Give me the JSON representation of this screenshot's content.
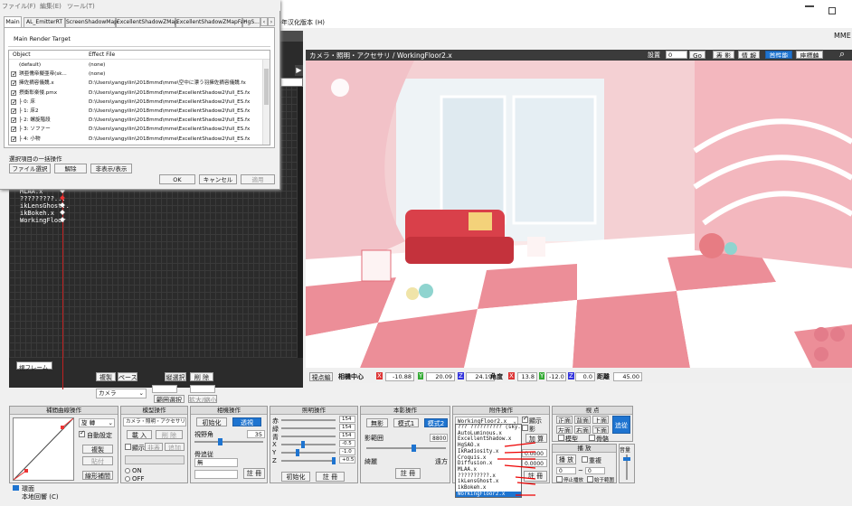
{
  "mmd": {
    "menu": [
      "ファイル(F)",
      "編集(E)",
      "ツール(T)"
    ],
    "title_fragment": "帰年汉化版本 (H)",
    "mme_label": "MME",
    "viewport_title": "カメラ・照明・アクセサリ / WorkingFloor2.x",
    "view_controls": {
      "display": "設置",
      "frame_value": "0",
      "go": "Go",
      "buttons": [
        "表 影",
        "情 報",
        "首性能",
        "座標軸"
      ]
    },
    "local_label": "LOCAL",
    "frame_tab": "視フレーム",
    "timeline_rows": [
      "MLAA.x",
      "?????????...",
      "ikLensGhost..",
      "ikBokeh.x",
      "WorkingFloor"
    ],
    "timeline_bottom": {
      "copy": "複製",
      "paste": "ペースト",
      "delete": "削 除",
      "range": "範囲選択",
      "vert_sel": "縦選択",
      "camera_select": "カメラ",
      "expand": "拡大/縮小"
    },
    "status": {
      "label": "視点編",
      "center": "相機中心",
      "x": "-10.88",
      "y": "20.09",
      "z": "24.19",
      "angle_label": "角度",
      "ax": "13.8",
      "ay": "-12.0",
      "az": "0.0",
      "dist_label": "距離",
      "dist": "45.00"
    },
    "panels": {
      "interp": {
        "title": "補間曲線操作",
        "select": "旋 轉",
        "auto": "自動設定",
        "copy": "複製",
        "paste": "貼付",
        "linear": "線形補間"
      },
      "model": {
        "title": "模型操作",
        "select": "カメラ・照明・アクセサリ",
        "register": "載 入",
        "delete": "削 除",
        "display": "顯示",
        "hide": "非表",
        "add": "追加",
        "on": "ON",
        "off": "OFF"
      },
      "camera": {
        "title": "相機操作",
        "init": "初始化",
        "perspective": "透視",
        "view_angle": "視野角",
        "angle_value": "35",
        "follow": "骨追従",
        "follow_select": "無",
        "register": "註 冊"
      },
      "lighting": {
        "title": "照明操作",
        "r_label": "赤",
        "g_label": "緑",
        "b_label": "青",
        "r": "154",
        "g": "154",
        "b": "154",
        "x": "-0.5",
        "y": "-1.0",
        "z": "+0.5",
        "init": "初始化",
        "register": "註 冊"
      },
      "shadow": {
        "title": "本影操作",
        "none": "無影",
        "mode1": "模式1",
        "mode2": "模式2",
        "range_label": "影範囲",
        "range": "8800",
        "near": "綺麗",
        "far": "遠方",
        "register": "註 冊"
      },
      "accessory": {
        "title": "附件操作",
        "selected": "WorkingFloor2.x",
        "show": "顯示",
        "shadow": "影",
        "add": "加 算",
        "value1": "0.0000",
        "value2": "0.0000",
        "register": "註 冊"
      },
      "view": {
        "title": "視 点",
        "front": "正面",
        "back": "背面",
        "top": "上面",
        "left": "左面",
        "right": "右面",
        "bottom": "下面",
        "follow": "追從",
        "model_cb": "模型",
        "bone_cb": "骨骼"
      },
      "playback": {
        "title": "播 放",
        "play": "播 放",
        "repeat": "重複",
        "from": "0",
        "to": "0",
        "stop_label": "停止播放",
        "range_label": "始于範圍"
      },
      "volume": {
        "title": "音量"
      }
    },
    "accessory_dropdown": [
      "??? ?????????? (sky..",
      "AutoLuminous.x",
      "ExcellentShadow.x",
      "HgSAO.x",
      "IkRadiosity.x",
      "Croquis.x",
      "Diffusion.x",
      "MLAA.x",
      "??????????.x",
      "ikLensGhost.x",
      "ikBokeh.x",
      "WorkingFloor2.x"
    ],
    "bottom_items": [
      "環面",
      "本地回響 (C)"
    ]
  },
  "mme": {
    "tabs": [
      "Main",
      "AL_EmitterRT",
      "ScreenShadowMap",
      "ExcellentShadowZMap",
      "ExcellentShadowZMapFar",
      "HgS..."
    ],
    "render_target": "Main Render Target",
    "col_object": "Object",
    "col_effect": "Effect File",
    "rows": [
      {
        "checked": false,
        "object": "(default)",
        "effect": "(none)"
      },
      {
        "checked": true,
        "object": "琪亜儒帝擬亜帝(sk...",
        "effect": "(none)"
      },
      {
        "checked": true,
        "object": "擁佐摘容儀魏.x",
        "effect": "D:\\Users\\yangyilin\\2018mmd\\mme\\空中に漂う羽擁佐摘容儀魏.fx"
      },
      {
        "checked": true,
        "object": "摂衝彰楽侵.pmx",
        "effect": "D:\\Users\\yangyilin\\2018mmd\\mme\\ExcellentShadow2\\full_ES.fx"
      },
      {
        "checked": true,
        "object": "├ 0: 床",
        "effect": "D:\\Users\\yangyilin\\2018mmd\\mme\\ExcellentShadow2\\full_ES.fx"
      },
      {
        "checked": true,
        "object": "├ 1: 床2",
        "effect": "D:\\Users\\yangyilin\\2018mmd\\mme\\ExcellentShadow2\\full_ES.fx"
      },
      {
        "checked": true,
        "object": "├ 2: 螺旋階段",
        "effect": "D:\\Users\\yangyilin\\2018mmd\\mme\\ExcellentShadow2\\full_ES.fx"
      },
      {
        "checked": true,
        "object": "├ 3: ソファー",
        "effect": "D:\\Users\\yangyilin\\2018mmd\\mme\\ExcellentShadow2\\full_ES.fx"
      },
      {
        "checked": true,
        "object": "├ 4: 小物",
        "effect": "D:\\Users\\yangyilin\\2018mmd\\mme\\ExcellentShadow2\\full_ES.fx"
      }
    ],
    "batch_label": "選択項目の一括操作",
    "file_select": "ファイル選択",
    "release": "解除",
    "hide_show": "非表示/表示",
    "ok": "OK",
    "cancel": "キャンセル",
    "apply": "適用"
  }
}
